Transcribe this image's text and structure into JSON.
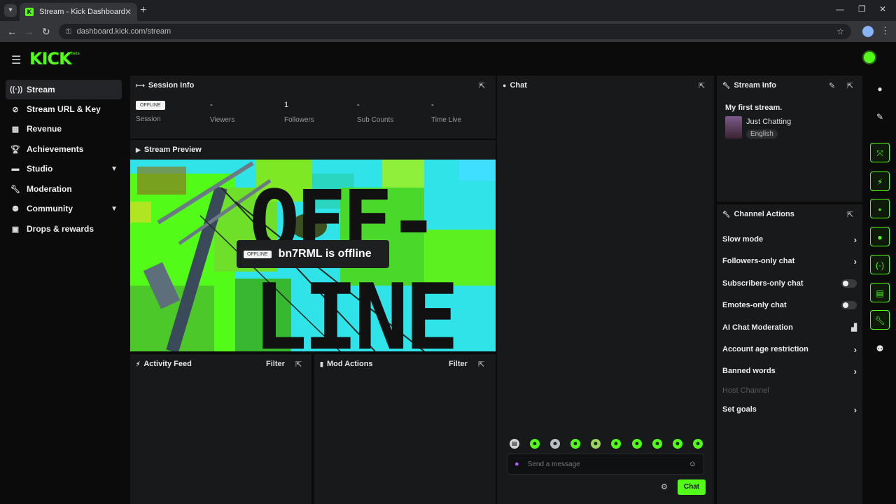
{
  "browser": {
    "tab_title": "Stream - Kick Dashboard",
    "url": "dashboard.kick.com/stream",
    "icons": [
      "tab-list-icon",
      "close-icon",
      "plus-icon",
      "minimize-icon",
      "restore-icon",
      "window-close-icon",
      "back-icon",
      "forward-icon",
      "reload-icon",
      "lock-icon",
      "star-icon",
      "profile-icon",
      "kebab-icon"
    ]
  },
  "header": {
    "logo": "KICK",
    "logo_sub": "beta"
  },
  "sidebar": {
    "items": [
      {
        "label": "Stream",
        "icon": "broadcast-icon"
      },
      {
        "label": "Stream URL & Key",
        "icon": "link-icon"
      },
      {
        "label": "Revenue",
        "icon": "revenue-icon"
      },
      {
        "label": "Achievements",
        "icon": "trophy-icon"
      },
      {
        "label": "Studio",
        "icon": "studio-icon"
      },
      {
        "label": "Moderation",
        "icon": "wrench-icon"
      },
      {
        "label": "Community",
        "icon": "community-icon"
      },
      {
        "label": "Drops & rewards",
        "icon": "gift-icon"
      }
    ]
  },
  "session_info": {
    "title": "Session Info",
    "offline_tag": "OFFLINE",
    "stats": [
      {
        "label": "Session",
        "value": ""
      },
      {
        "label": "Viewers",
        "value": "-"
      },
      {
        "label": "Followers",
        "value": "1"
      },
      {
        "label": "Sub Counts",
        "value": "-"
      },
      {
        "label": "Time Live",
        "value": "-"
      }
    ]
  },
  "stream_preview": {
    "title": "Stream Preview",
    "badge": "OFFLINE",
    "status_text": "bn7RML is offline",
    "art_text_top": "OFF-",
    "art_text_bottom": "LINE"
  },
  "activity_feed": {
    "title": "Activity Feed",
    "filter": "Filter"
  },
  "mod_actions": {
    "title": "Mod Actions",
    "filter": "Filter"
  },
  "chat": {
    "title": "Chat",
    "placeholder": "Send a message",
    "send_label": "Chat"
  },
  "stream_info": {
    "title": "Stream Info",
    "stream_title": "My first stream.",
    "category": "Just Chatting",
    "language": "English"
  },
  "channel_actions": {
    "title": "Channel Actions",
    "rows": [
      {
        "label": "Slow mode",
        "control": "arrow"
      },
      {
        "label": "Followers-only chat",
        "control": "arrow"
      },
      {
        "label": "Subscribers-only chat",
        "control": "toggle"
      },
      {
        "label": "Emotes-only chat",
        "control": "toggle"
      },
      {
        "label": "AI Chat Moderation",
        "control": "chart"
      },
      {
        "label": "Account age restriction",
        "control": "arrow"
      },
      {
        "label": "Banned words",
        "control": "arrow"
      },
      {
        "label": "Host Channel",
        "control": "none"
      },
      {
        "label": "Set goals",
        "control": "arrow"
      }
    ]
  },
  "colors": {
    "accent": "#53fc18",
    "background": "#0b0b0c",
    "panel": "#18191b"
  }
}
